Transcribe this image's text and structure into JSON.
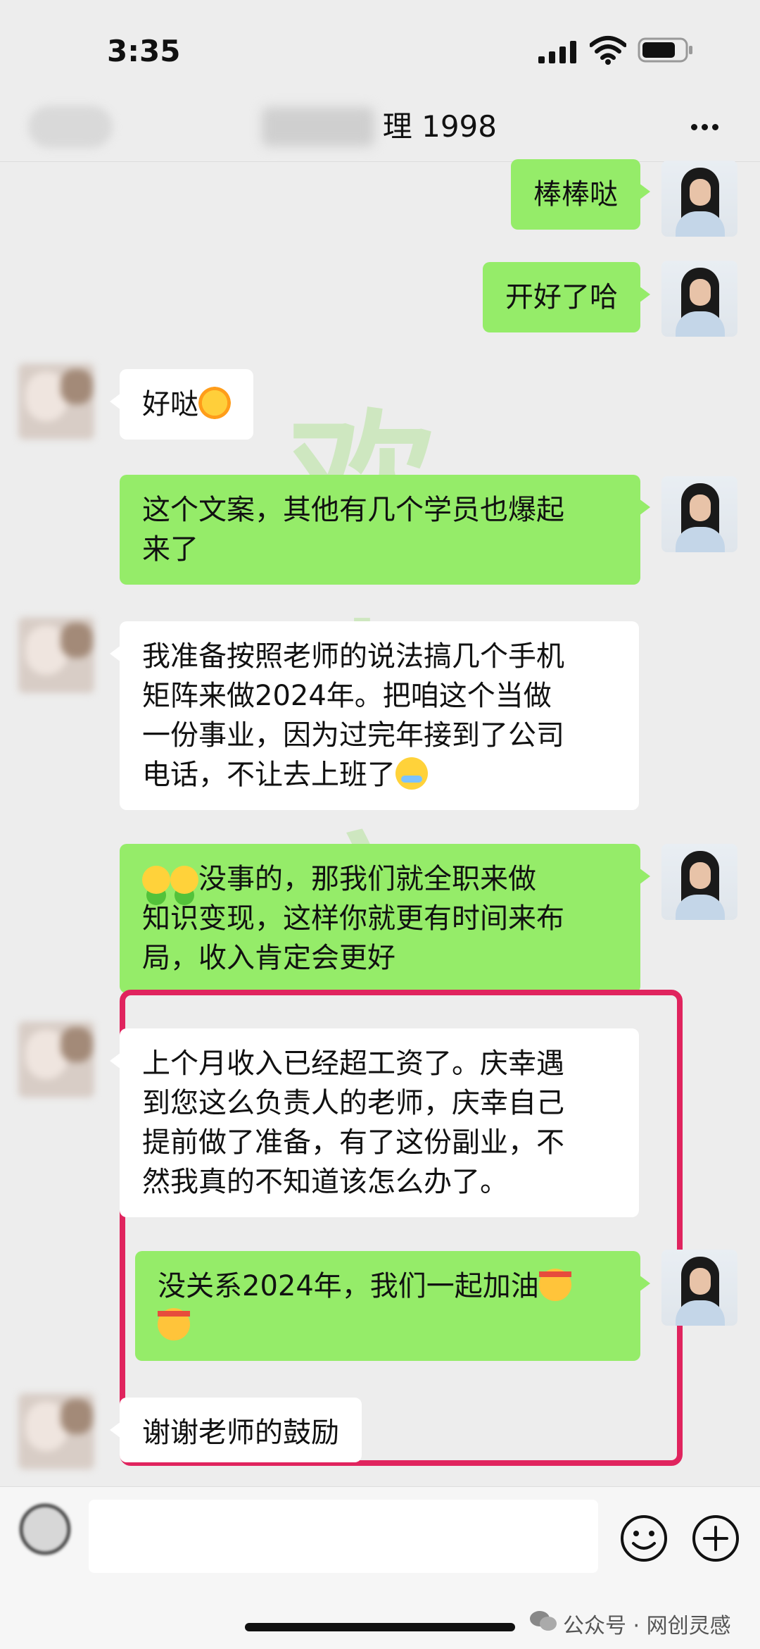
{
  "status_bar": {
    "time": "3:35"
  },
  "header": {
    "title_visible": "理 1998"
  },
  "messages": [
    {
      "side": "out",
      "lines": [
        "棒棒哒"
      ]
    },
    {
      "side": "out",
      "lines": [
        "开好了哈"
      ]
    },
    {
      "side": "in",
      "lines": [
        "好哒"
      ],
      "emoji": "sun-emoji"
    },
    {
      "side": "out",
      "lines": [
        "这个文案，其他有几个学员也爆起",
        "来了"
      ]
    },
    {
      "side": "in",
      "lines": [
        "我准备按照老师的说法搞几个手机",
        "矩阵来做2024年。把咱这个当做",
        "一份事业，因为过完年接到了公司",
        "电话，不让去上班了"
      ],
      "emoji": "cry-emoji"
    },
    {
      "side": "out",
      "lines": [
        "没事的，那我们就全职来做",
        "知识变现，这样你就更有时间来布",
        "局，收入肯定会更好"
      ],
      "emoji": "shrug-emoji"
    },
    {
      "side": "in",
      "lines": [
        "上个月收入已经超工资了。庆幸遇",
        "到您这么负责人的老师，庆幸自己",
        "提前做了准备，有了这份副业，不",
        "然我真的不知道该怎么办了。"
      ]
    },
    {
      "side": "out",
      "lines": [
        "没关系2024年，我们一起加油"
      ],
      "emoji": "fight-emoji"
    },
    {
      "side": "in",
      "lines": [
        "谢谢老师的鼓励"
      ]
    }
  ],
  "watermark": {
    "chars": [
      "欢",
      "喜",
      "安",
      "贵"
    ]
  },
  "input": {
    "placeholder": ""
  },
  "footer": {
    "source": "公众号 · 网创灵感"
  },
  "colors": {
    "outgoing_bubble": "#95ec69",
    "incoming_bubble": "#ffffff",
    "highlight": "#e0245e",
    "background": "#ededed"
  }
}
